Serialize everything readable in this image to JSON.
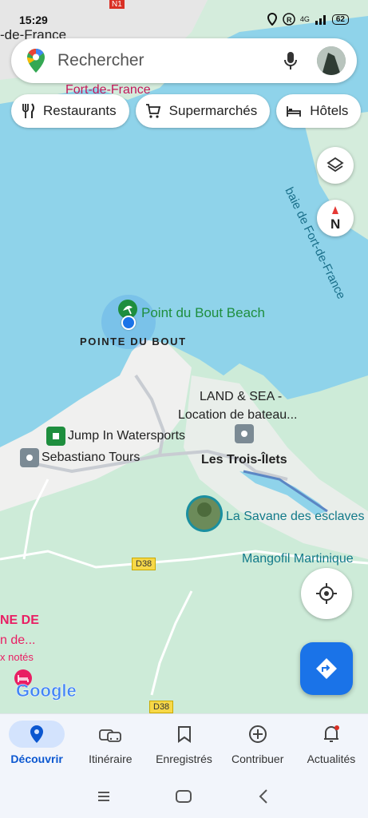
{
  "status_bar": {
    "time": "15:29",
    "battery": "62",
    "network": "4G",
    "left_label": "-de-France"
  },
  "search": {
    "placeholder": "Rechercher"
  },
  "chips": [
    {
      "label": "Restaurants",
      "icon": "fork-knife-icon"
    },
    {
      "label": "Supermarchés",
      "icon": "cart-icon"
    },
    {
      "label": "Hôtels",
      "icon": "bed-icon"
    }
  ],
  "map": {
    "labels": {
      "fort_de_france": "Fort-de-France",
      "baie": "baie de Fort-de-France",
      "point_du_bout_beach": "Point du Bout Beach",
      "pointe_du_bout": "POINTE DU BOUT",
      "land_sea_1": "LAND & SEA -",
      "land_sea_2": "Location de bateau...",
      "jump_in": "Jump In Watersports",
      "sebastiano": "Sebastiano Tours",
      "trois_ilets": "Les Trois-Îlets",
      "savane": "La Savane des esclaves",
      "mangofil": "Mangofil Martinique",
      "road_d38_a": "D38",
      "road_d38_b": "D38",
      "road_n1": "N1",
      "hotel_1": "NE DE",
      "hotel_2": "n de...",
      "hotel_3": "x notés",
      "google": "Google"
    },
    "compass_letter": "N"
  },
  "bottom_nav": [
    {
      "label": "Découvrir",
      "icon": "location-pin-icon",
      "active": true
    },
    {
      "label": "Itinéraire",
      "icon": "car-icon",
      "active": false
    },
    {
      "label": "Enregistrés",
      "icon": "bookmark-icon",
      "active": false
    },
    {
      "label": "Contribuer",
      "icon": "add-circle-icon",
      "active": false
    },
    {
      "label": "Actualités",
      "icon": "bell-icon",
      "active": false
    }
  ],
  "colors": {
    "water": "#7fcfe6",
    "land": "#cdebd8",
    "accent": "#1a73e8",
    "active_pill": "#d3e3fd"
  }
}
